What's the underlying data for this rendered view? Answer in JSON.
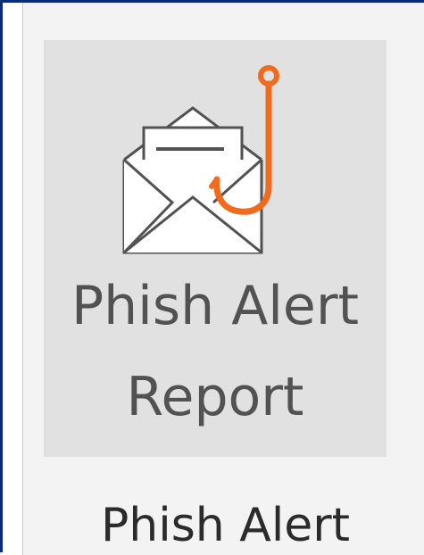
{
  "ribbon": {
    "button": {
      "label_line1": "Phish Alert",
      "label_line2": "Report",
      "icon": "envelope-fishhook-icon"
    },
    "group_label": "Phish Alert"
  },
  "colors": {
    "hook": "#f26a1b",
    "envelope_stroke": "#525252",
    "button_background": "#e1e1e1",
    "group_background": "#f3f3f3",
    "frame_border": "#0a2a7a"
  }
}
